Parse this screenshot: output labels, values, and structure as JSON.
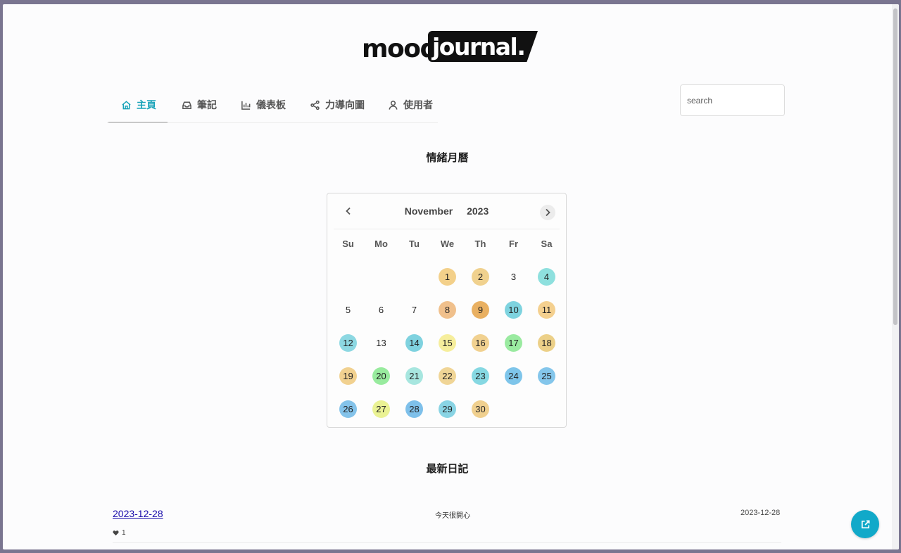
{
  "logo": {
    "part1": "mood",
    "part2": "journal."
  },
  "nav": {
    "items": [
      {
        "label": "主頁",
        "icon": "home-icon"
      },
      {
        "label": "筆記",
        "icon": "inbox-icon"
      },
      {
        "label": "儀表板",
        "icon": "bar-chart-icon"
      },
      {
        "label": "力導向圖",
        "icon": "share-icon"
      },
      {
        "label": "使用者",
        "icon": "user-icon"
      }
    ]
  },
  "search": {
    "placeholder": "search",
    "value": ""
  },
  "calendar_section": {
    "title": "情緒月曆"
  },
  "calendar": {
    "month": "November",
    "year": "2023",
    "weekdays": [
      "Su",
      "Mo",
      "Tu",
      "We",
      "Th",
      "Fr",
      "Sa"
    ],
    "weeks": [
      [
        null,
        null,
        null,
        {
          "d": "1",
          "color": "#f3d08a"
        },
        {
          "d": "2",
          "color": "#f0d18e"
        },
        {
          "d": "3",
          "color": null
        },
        {
          "d": "4",
          "color": "#8ee0de"
        }
      ],
      [
        {
          "d": "5",
          "color": null
        },
        {
          "d": "6",
          "color": null
        },
        {
          "d": "7",
          "color": null
        },
        {
          "d": "8",
          "color": "#f0c08c"
        },
        {
          "d": "9",
          "color": "#e9b061"
        },
        {
          "d": "10",
          "color": "#7ed3df"
        },
        {
          "d": "11",
          "color": "#f4d08f"
        }
      ],
      [
        {
          "d": "12",
          "color": "#8dd8e2"
        },
        {
          "d": "13",
          "color": null
        },
        {
          "d": "14",
          "color": "#7fd2df"
        },
        {
          "d": "15",
          "color": "#f6ee9c"
        },
        {
          "d": "16",
          "color": "#f1d190"
        },
        {
          "d": "17",
          "color": "#9aeaa0"
        },
        {
          "d": "18",
          "color": "#ecd088"
        }
      ],
      [
        {
          "d": "19",
          "color": "#f1d190"
        },
        {
          "d": "20",
          "color": "#98eb9e"
        },
        {
          "d": "21",
          "color": "#a7e6df"
        },
        {
          "d": "22",
          "color": "#f0d596"
        },
        {
          "d": "23",
          "color": "#86d8e2"
        },
        {
          "d": "24",
          "color": "#7ec5ea"
        },
        {
          "d": "25",
          "color": "#84c6eb"
        }
      ],
      [
        {
          "d": "26",
          "color": "#84c3ea"
        },
        {
          "d": "27",
          "color": "#eaf294"
        },
        {
          "d": "28",
          "color": "#7ec0ea"
        },
        {
          "d": "29",
          "color": "#89d4e4"
        },
        {
          "d": "30",
          "color": "#f0d08f"
        },
        null,
        null
      ]
    ]
  },
  "latest_section": {
    "title": "最新日記"
  },
  "entries": [
    {
      "title": "2023-12-28",
      "content": "今天很開心",
      "date": "2023-12-28",
      "likes": "1"
    }
  ]
}
